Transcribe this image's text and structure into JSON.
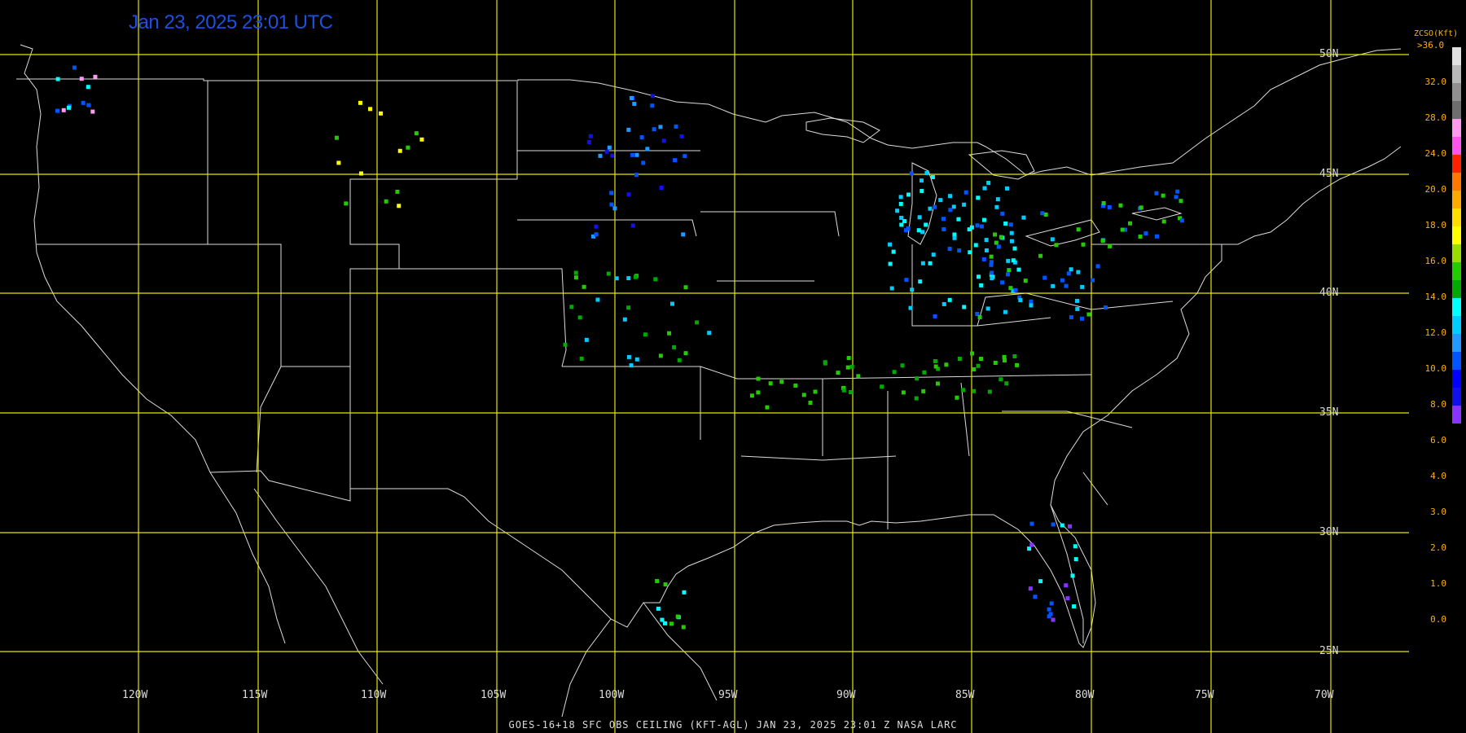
{
  "header": {
    "timestamp": "Jan 23, 2025 23:01 UTC"
  },
  "footer": {
    "caption": "GOES-16+18  SFC OBS CEILING (KFT-AGL)   JAN 23, 2025 23:01 Z   NASA LARC"
  },
  "grid": {
    "latitudes": [
      "50N",
      "45N",
      "40N",
      "35N",
      "30N",
      "25N"
    ],
    "longitudes": [
      "120W",
      "115W",
      "110W",
      "105W",
      "100W",
      "95W",
      "90W",
      "85W",
      "80W",
      "75W",
      "70W"
    ]
  },
  "legend": {
    "title": "ZCSO(Kft)",
    "max_label": ">36.0",
    "labels": [
      "32.0",
      "28.0",
      "24.0",
      "20.0",
      "18.0",
      "16.0",
      "14.0",
      "12.0",
      "10.0",
      "8.0",
      "6.0",
      "4.0",
      "3.0",
      "2.0",
      "1.0",
      "0.0"
    ],
    "colors": [
      "#e0e0e0",
      "#b8b8b8",
      "#909090",
      "#6e6e6e",
      "#ff99ee",
      "#ff55ee",
      "#ff2200",
      "#ff7700",
      "#ffaa00",
      "#ffdd00",
      "#ffff00",
      "#99dd00",
      "#22cc00",
      "#00aa00",
      "#00ffff",
      "#00ccff",
      "#2299ff",
      "#0055ff",
      "#0000ff",
      "#1111ee",
      "#8833ff"
    ]
  }
}
